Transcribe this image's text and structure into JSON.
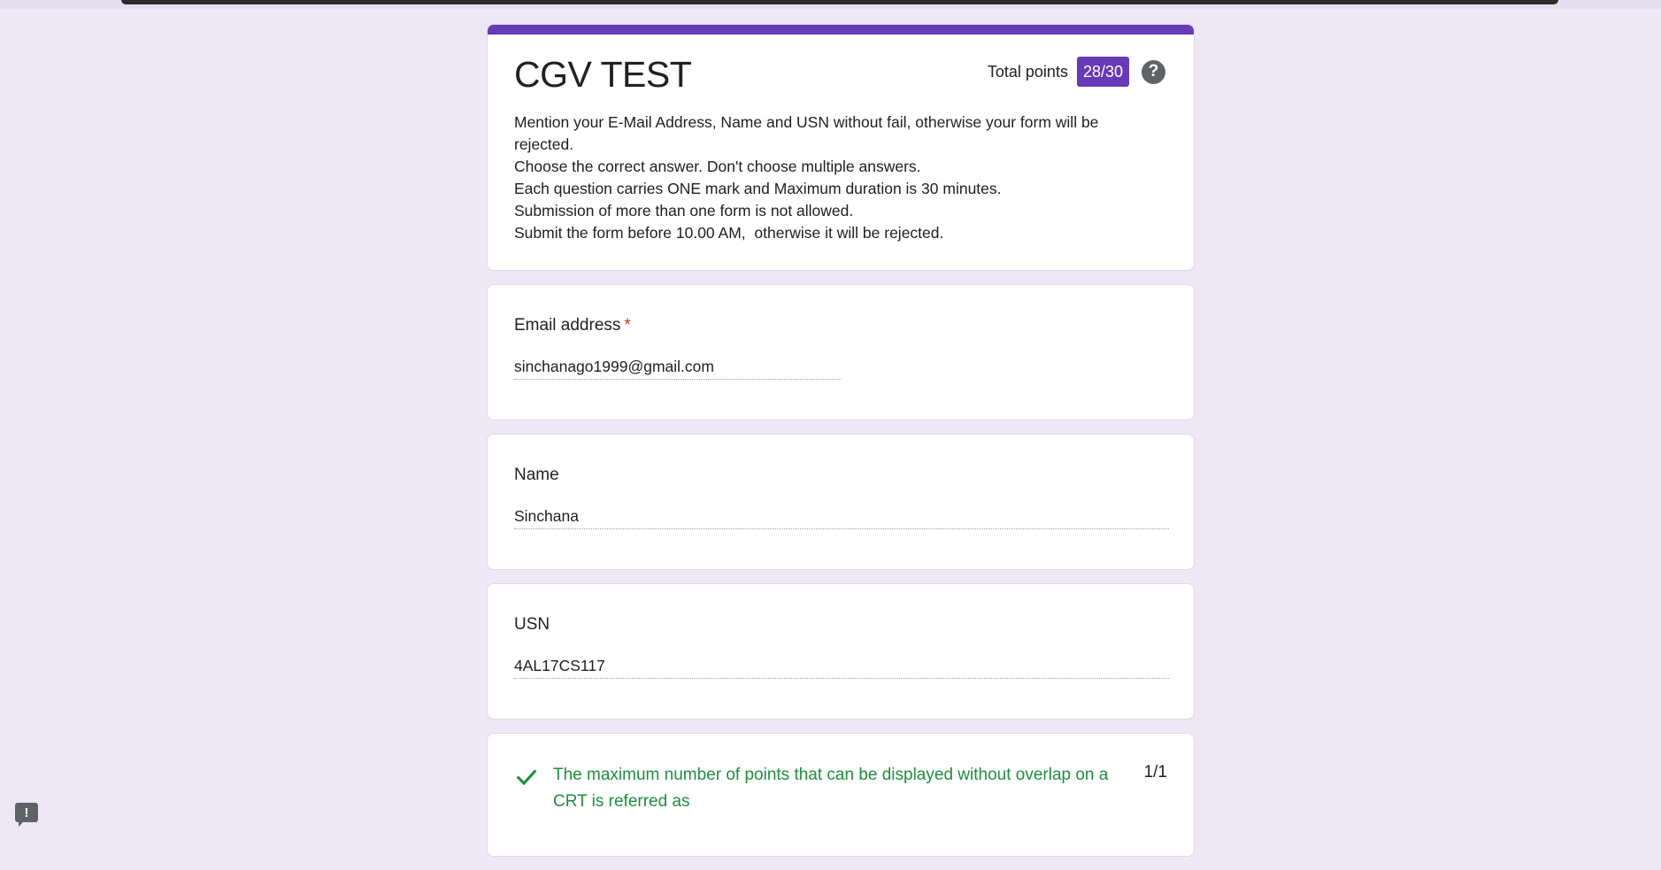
{
  "form": {
    "title": "CGV TEST",
    "total_points_label": "Total points",
    "total_points_value": "28/30",
    "help_icon": "help-circle-icon",
    "description_lines": [
      "Mention your E-Mail Address, Name and USN without fail, otherwise your form will be rejected.",
      "Choose the correct answer. Don't choose multiple answers.",
      "Each question carries ONE mark and Maximum duration is 30 minutes.",
      "Submission of more than one form is not allowed.",
      "Submit the form before 10.00 AM,  otherwise it will be rejected."
    ],
    "accent_color": "#673ab7",
    "correct_color": "#1e8e3e"
  },
  "questions": {
    "email": {
      "label": "Email address",
      "required_marker": "*",
      "answer": "sinchanago1999@gmail.com"
    },
    "name": {
      "label": "Name",
      "answer": "Sinchana"
    },
    "usn": {
      "label": "USN",
      "answer": "4AL17CS117"
    },
    "quiz1": {
      "status_icon": "check-icon",
      "text": "The maximum number of points that can be displayed without overlap on a CRT is referred as",
      "score": "1/1"
    }
  },
  "feedback": {
    "icon": "feedback-icon",
    "glyph": "!"
  }
}
